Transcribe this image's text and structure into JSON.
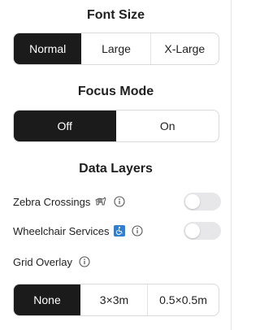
{
  "font_size": {
    "title": "Font Size",
    "options": [
      "Normal",
      "Large",
      "X-Large"
    ],
    "selected": "Normal"
  },
  "focus_mode": {
    "title": "Focus Mode",
    "options": [
      "Off",
      "On"
    ],
    "selected": "Off"
  },
  "data_layers": {
    "title": "Data Layers",
    "zebra": {
      "label": "Zebra Crossings",
      "icon": "zebra-icon",
      "enabled": false
    },
    "wheelchair": {
      "label": "Wheelchair Services",
      "icon": "wheelchair-icon",
      "enabled": false
    },
    "grid": {
      "label": "Grid Overlay",
      "options": [
        "None",
        "3×3m",
        "0.5×0.5m"
      ],
      "selected": "None"
    }
  },
  "colors": {
    "active_bg": "#1b1b1b",
    "toggle_off": "#e7e7ea",
    "wheelchair_badge": "#2f7fd6"
  }
}
